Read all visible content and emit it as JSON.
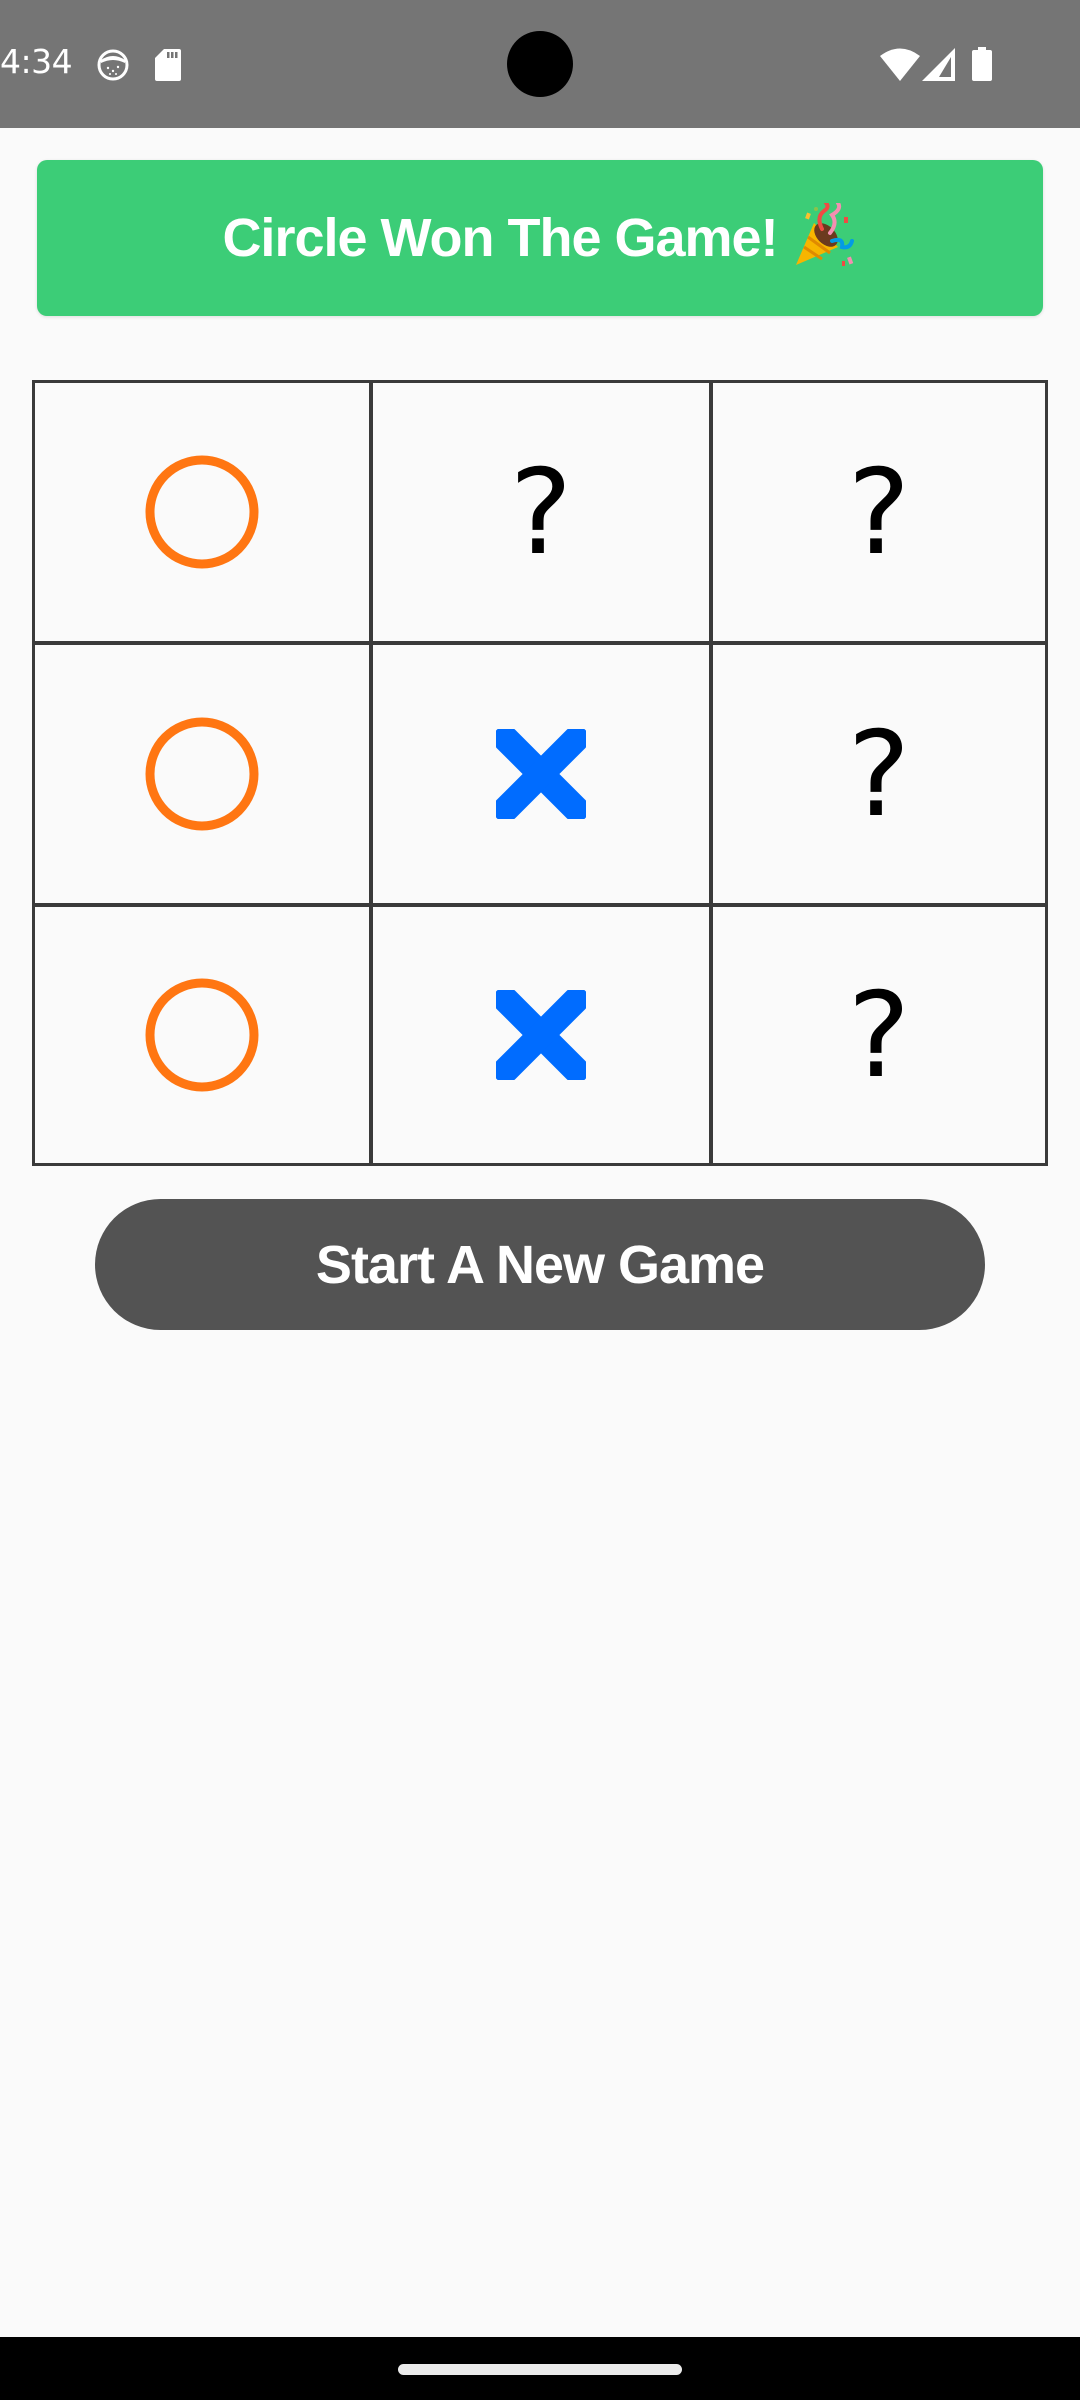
{
  "status_bar": {
    "time": "4:34",
    "left_icons": [
      "cat-notification-icon",
      "sd-card-icon"
    ],
    "right_icons": [
      "wifi-icon",
      "cellular-signal-icon",
      "battery-icon"
    ]
  },
  "banner": {
    "message": "Circle Won The Game!",
    "emoji": "party-popper-icon",
    "color": "#3ccd77"
  },
  "board": {
    "rows": 3,
    "cols": 3,
    "cells": [
      [
        "O",
        "?",
        "?"
      ],
      [
        "O",
        "X",
        "?"
      ],
      [
        "O",
        "X",
        "?"
      ]
    ],
    "empty_symbol": "?",
    "colors": {
      "circle": "#ff7612",
      "cross": "#006cff",
      "grid": "#3a3a3a"
    }
  },
  "actions": {
    "new_game_label": "Start A New Game"
  }
}
